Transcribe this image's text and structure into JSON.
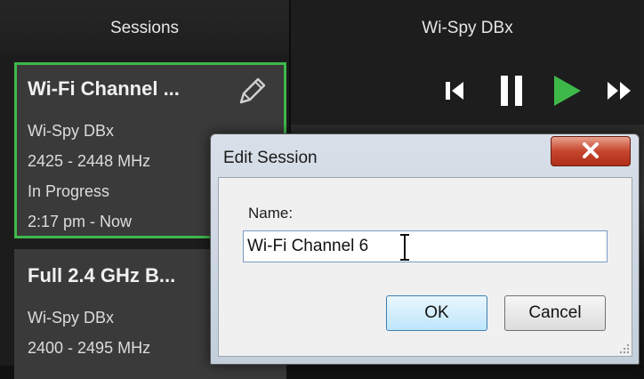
{
  "sessions_panel": {
    "header": "Sessions",
    "cards": [
      {
        "title": "Wi-Fi Channel ...",
        "device": "Wi-Spy DBx",
        "frequency": "2425 - 2448 MHz",
        "status": "In Progress",
        "time": "2:17 pm - Now",
        "active": true
      },
      {
        "title": "Full 2.4 GHz B...",
        "device": "Wi-Spy DBx",
        "frequency": "2400 - 2495 MHz",
        "active": false
      }
    ]
  },
  "player_panel": {
    "header": "Wi-Spy DBx",
    "controls": [
      "skip-back-icon",
      "pause-icon",
      "play-icon",
      "fast-forward-icon"
    ]
  },
  "dialog": {
    "title": "Edit Session",
    "name_label": "Name:",
    "name_value": "Wi-Fi Channel 6",
    "ok_label": "OK",
    "cancel_label": "Cancel"
  },
  "colors": {
    "active_border": "#3fb84a",
    "play_green": "#3fb84a",
    "close_red": "#c6452d"
  }
}
